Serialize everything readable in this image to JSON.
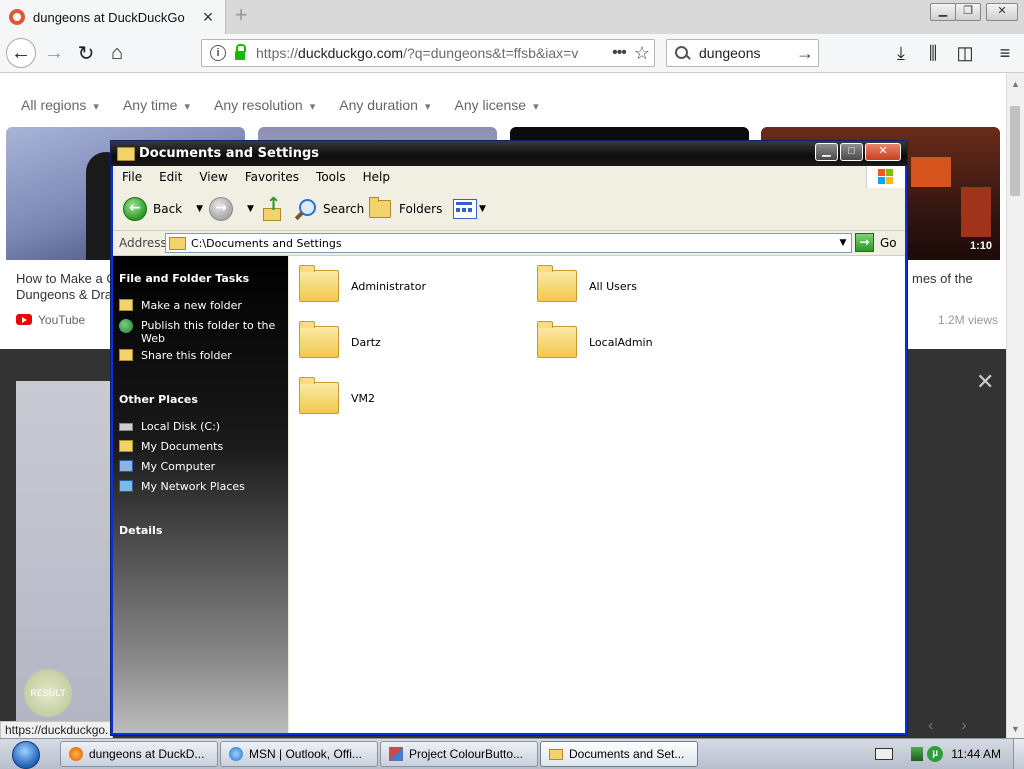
{
  "browser": {
    "tab_title": "dungeons at DuckDuckGo",
    "url_prefix": "https://",
    "url_host": "duckduckgo.com",
    "url_rest": "/?q=dungeons&t=ffsb&iax=v",
    "search_query": "dungeons",
    "status_url": "https://duckduckgo."
  },
  "ddg": {
    "filters": [
      "All regions",
      "Any time",
      "Any resolution",
      "Any duration",
      "Any license"
    ],
    "card1_title": "How to Make a C\nDungeons & Dra",
    "card1_source": "YouTube",
    "card4_duration": "1:10",
    "card4_title": "mes of the",
    "card4_views": "1.2M views",
    "result_badge": "RESULT"
  },
  "explorer": {
    "title": "Documents and Settings",
    "menu": [
      "File",
      "Edit",
      "View",
      "Favorites",
      "Tools",
      "Help"
    ],
    "toolbar": {
      "back": "Back",
      "search": "Search",
      "folders": "Folders"
    },
    "address_label": "Address",
    "address_value": "C:\\Documents and Settings",
    "go_label": "Go",
    "task_pane": {
      "file_tasks_header": "File and Folder Tasks",
      "file_tasks": [
        "Make a new folder",
        "Publish this folder to the Web",
        "Share this folder"
      ],
      "other_places_header": "Other Places",
      "other_places": [
        "Local Disk (C:)",
        "My Documents",
        "My Computer",
        "My Network Places"
      ],
      "details_header": "Details"
    },
    "folders": [
      "Administrator",
      "All Users",
      "Dartz",
      "LocalAdmin",
      "VM2"
    ]
  },
  "taskbar": {
    "items": [
      {
        "label": "dungeons at DuckD...",
        "icon": "firefox-icon"
      },
      {
        "label": "MSN | Outlook, Offi...",
        "icon": "ie-icon"
      },
      {
        "label": "Project ColourButto...",
        "icon": "project-icon"
      },
      {
        "label": "Documents and Set...",
        "icon": "folder-icon"
      }
    ],
    "active_index": 3,
    "clock": "11:44 AM"
  }
}
